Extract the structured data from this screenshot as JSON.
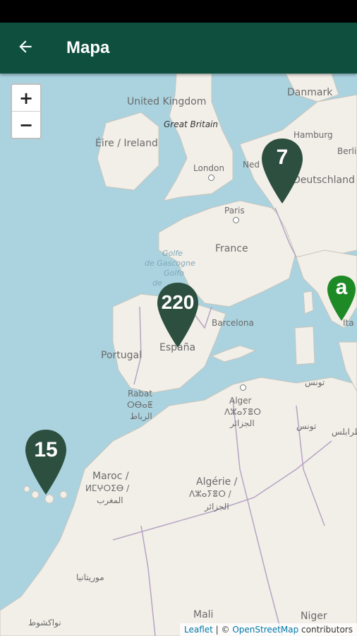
{
  "app_bar": {
    "title": "Mapa",
    "back_icon": "arrow-left-icon",
    "background": "#0e4f3d"
  },
  "map": {
    "zoom_in_label": "+",
    "zoom_out_label": "−",
    "sea_color": "#aad3df",
    "land_color": "#f2efe9",
    "labels": {
      "united_kingdom": "United Kingdom",
      "great_britain": "Great Britain",
      "eire": "Éire / Ireland",
      "london": "London",
      "danmark": "Danmark",
      "hamburg": "Hamburg",
      "berlin": "Berli",
      "ned": "Ned",
      "deutschland": "Deutschland",
      "paris": "Paris",
      "france": "France",
      "golfe1": "Golfe",
      "golfe2": "de Gascogne",
      "golfe3": "Golfo",
      "golfe4": "de",
      "italia": "Ita",
      "barcelona": "Barcelona",
      "espana": "España",
      "portugal": "Portugal",
      "rabat": "Rabat",
      "rabat_tif": "ⵔⴱⴰⵟ",
      "rabat_ar": "الرباط",
      "alger": "Alger",
      "alger_tif": "ⴷⵣⴰⵢⴻⵔ",
      "alger_ar": "الجزائر",
      "tunis_ar1": "تونس",
      "tunis_ar2": "تونس",
      "tripoli_ar": "طرابلس",
      "maroc": "Maroc /",
      "maroc_tif": "ⵍⵎⵖⵔⵉⴱ /",
      "maroc_ar": "المغرب",
      "algerie": "Algérie /",
      "algerie_tif": "ⴷⵣⴰⵢⴻⵔ /",
      "algerie_ar": "الجزائر",
      "mauritania_ar": "موريتانيا",
      "nouakchott_ar": "نواكشوط",
      "mali": "Mali",
      "niger": "Niger"
    }
  },
  "markers": [
    {
      "count": "7",
      "color": "#2d4f40"
    },
    {
      "count": "220",
      "color": "#2d4f40"
    },
    {
      "count": "15",
      "color": "#2d4f40"
    },
    {
      "count": "a",
      "color": "#1e8a26"
    }
  ],
  "attribution": {
    "leaflet": "Leaflet",
    "separator": " | © ",
    "osm": "OpenStreetMap",
    "contributors": " contributors"
  }
}
